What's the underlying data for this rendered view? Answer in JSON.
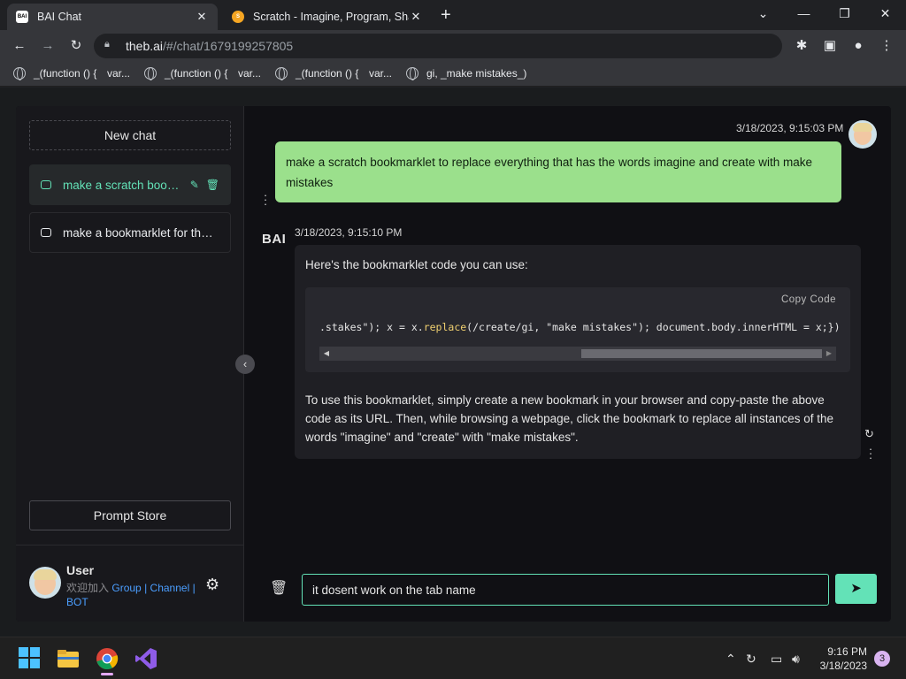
{
  "browser": {
    "tabs": [
      {
        "title": "BAI Chat",
        "favicon": "BAI",
        "active": true
      },
      {
        "title": "Scratch - Imagine, Program, Shar",
        "favicon": "S",
        "active": false
      }
    ],
    "new_tab": "+",
    "url_host": "theb.ai",
    "url_path": "/#/chat/1679199257805",
    "bookmarks": [
      {
        "label": "_(function () {"
      },
      {
        "label": "var..."
      },
      {
        "label": "_(function () {"
      },
      {
        "label": "var..."
      },
      {
        "label": "_(function () {"
      },
      {
        "label": "var..."
      },
      {
        "label": "gi, _make mistakes_)"
      }
    ]
  },
  "sidebar": {
    "new_chat": "New chat",
    "conversations": [
      {
        "title": "make a scratch bookmarklet to replace everything",
        "active": true
      },
      {
        "title": "make a bookmarklet for the tab name",
        "active": false
      }
    ],
    "prompt_store": "Prompt Store",
    "user": {
      "name": "User",
      "prefix": "欢迎加入",
      "link_group": "Group",
      "sep1": "|",
      "link_channel": "Channel",
      "sep2": "|",
      "link_bot": "BOT"
    }
  },
  "chat": {
    "user_timestamp": "3/18/2023, 9:15:03 PM",
    "user_message": "make a scratch bookmarklet to replace everything that has the words imagine and create with make mistakes",
    "bot_logo": "BAI",
    "bot_timestamp": "3/18/2023, 9:15:10 PM",
    "bot_intro": "Here's the bookmarklet code you can use:",
    "copy_code": "Copy  Code",
    "code": {
      "part1": ".stakes\"); x = x.",
      "fn": "replace",
      "part2": "(/create/gi, \"make mistakes\"); document.body.innerHTML = x;})();"
    },
    "bot_outro": "To use this bookmarklet, simply create a new bookmark in your browser and copy-paste the above code as its URL. Then, while browsing a webpage, click the bookmark to replace all instances of the words \"imagine\" and \"create\" with \"make mistakes\".",
    "input_value": "it dosent work on the tab name"
  },
  "taskbar": {
    "time": "9:16 PM",
    "date": "3/18/2023",
    "notifications": "3"
  },
  "colors": {
    "accent": "#63e2b7",
    "user_bubble": "#9be08c",
    "link": "#4b9eff"
  }
}
